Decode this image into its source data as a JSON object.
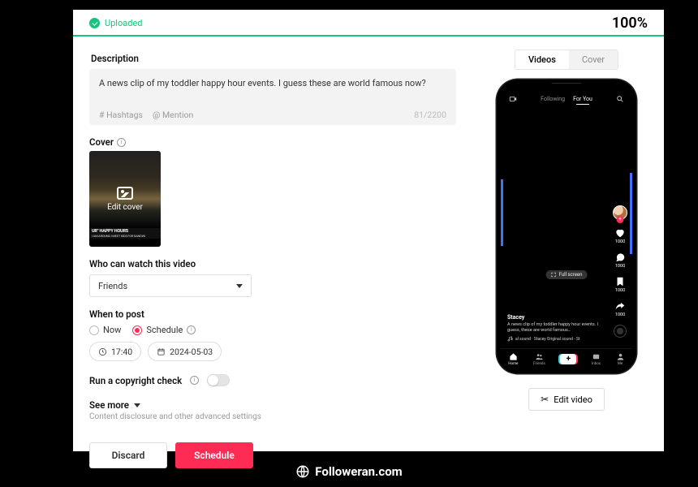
{
  "upload": {
    "status": "Uploaded",
    "percent": "100%"
  },
  "description": {
    "label": "Description",
    "text": "A news clip of my toddler happy hour events. I guess these are world famous now?",
    "hashtag_hint": "# Hashtags",
    "mention_hint": "@ Mention",
    "counter": "81/2200"
  },
  "cover": {
    "label": "Cover",
    "edit_label": "Edit cover",
    "caption_line1": "UR\" HAPPY HOURS",
    "caption_line2": "I AM AROUND I MEET KIDS FOR SANDWI"
  },
  "privacy": {
    "label": "Who can watch this video",
    "selected": "Friends"
  },
  "when": {
    "label": "When to post",
    "now": "Now",
    "schedule": "Schedule",
    "time": "17:40",
    "date": "2024-05-03"
  },
  "copyright": {
    "label": "Run a copyright check"
  },
  "seemore": {
    "label": "See more",
    "sub": "Content disclosure and other advanced settings"
  },
  "actions": {
    "discard": "Discard",
    "schedule": "Schedule"
  },
  "preview": {
    "tab_videos": "Videos",
    "tab_cover": "Cover",
    "feed_following": "Following",
    "feed_foryou": "For You",
    "fullscreen": "Full screen",
    "likes": "1000",
    "comments": "1000",
    "saves": "1000",
    "shares": "1000",
    "user": "Stacey",
    "caption": "A news clip of my toddler happy hour events. I guess, these are world famous…",
    "sound": "al sound · Stacey    Original sound - St",
    "nav_home": "Home",
    "nav_friends": "Friends",
    "nav_inbox": "Inbox",
    "nav_me": "Me",
    "edit_video": "Edit video"
  },
  "footer": {
    "brand": "Followeran.com"
  }
}
